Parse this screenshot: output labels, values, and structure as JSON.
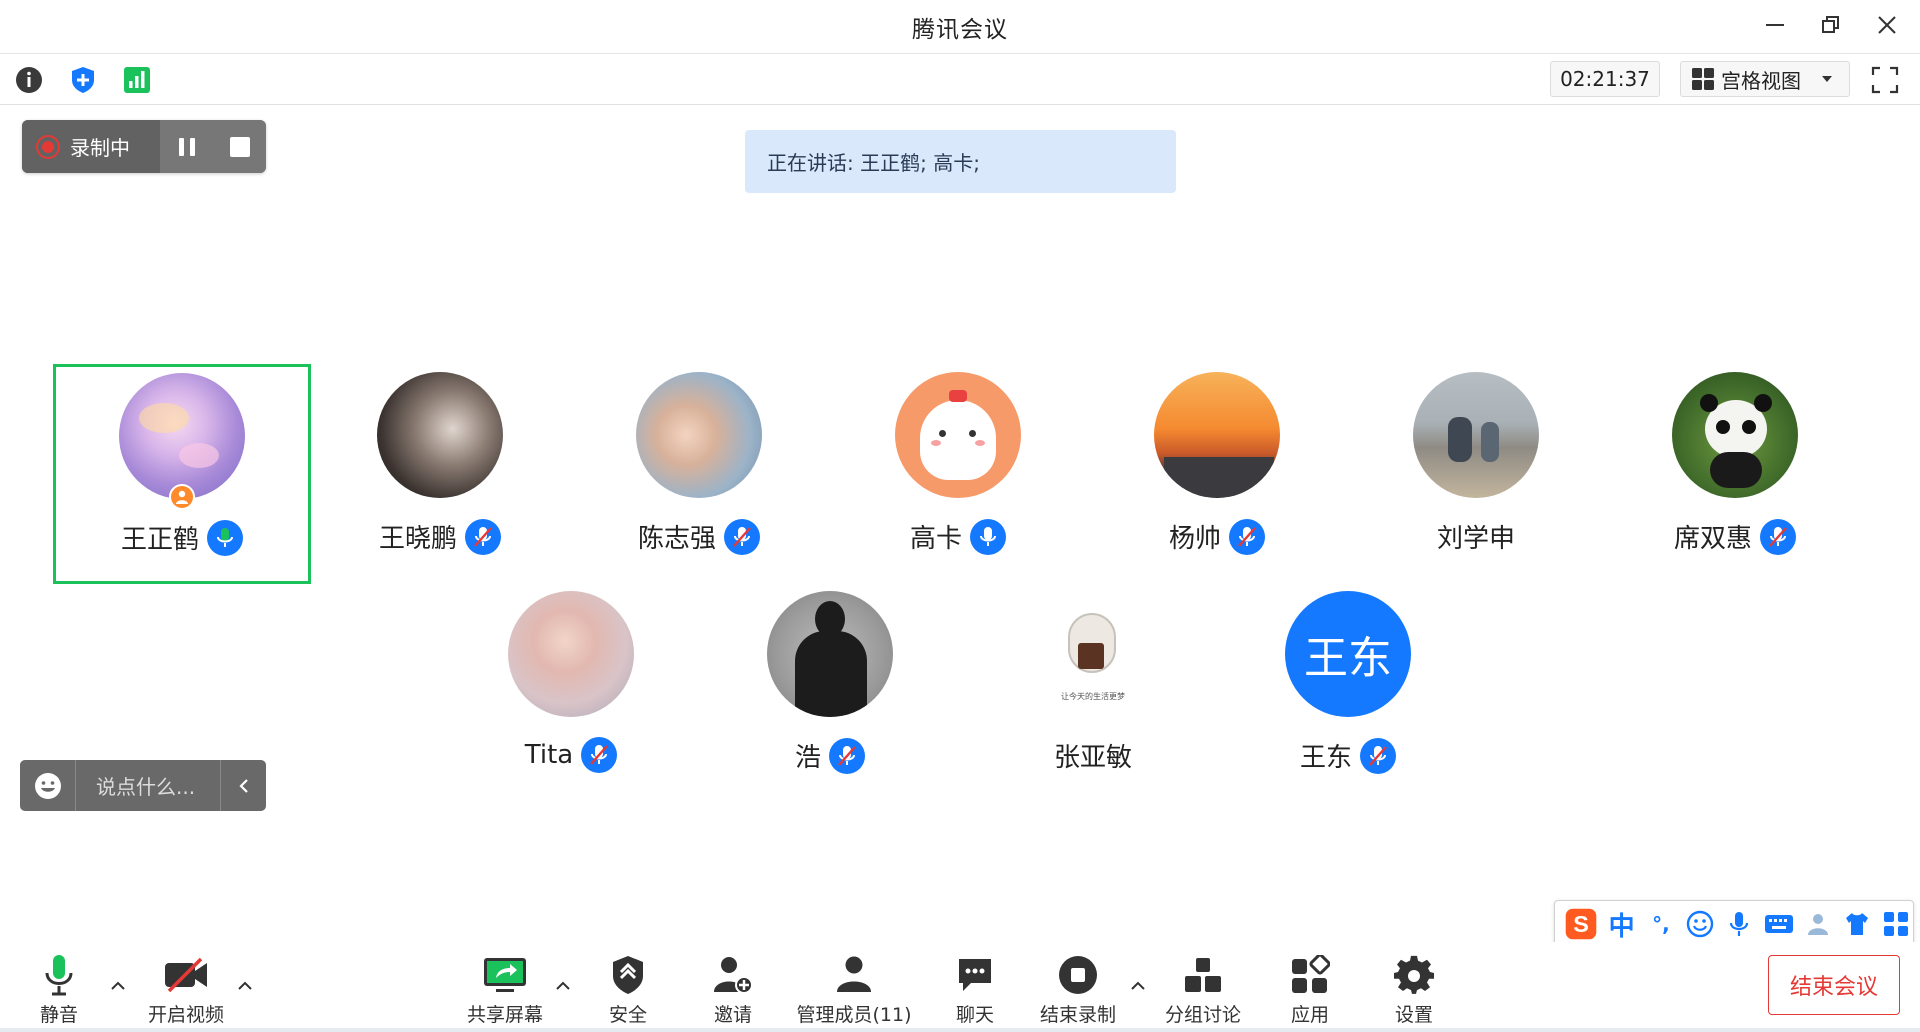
{
  "window": {
    "title": "腾讯会议"
  },
  "infobar": {
    "timer": "02:21:37",
    "view_label": "宫格视图"
  },
  "recording": {
    "status": "录制中"
  },
  "speaking": {
    "text": "正在讲话: 王正鹤; 高卡;"
  },
  "participants": [
    {
      "name": "王正鹤",
      "mic": "on-green",
      "host": true,
      "active": true
    },
    {
      "name": "王晓鹏",
      "mic": "muted"
    },
    {
      "name": "陈志强",
      "mic": "muted"
    },
    {
      "name": "高卡",
      "mic": "on"
    },
    {
      "name": "杨帅",
      "mic": "muted"
    },
    {
      "name": "刘学申",
      "mic": "none"
    },
    {
      "name": "席双惠",
      "mic": "muted"
    },
    {
      "name": "Tita",
      "mic": "muted"
    },
    {
      "name": "浩",
      "mic": "muted"
    },
    {
      "name": "张亚敏",
      "mic": "none",
      "avatar_caption": "让今天的生活更梦"
    },
    {
      "name": "王东",
      "mic": "muted",
      "avatar_text": "王东",
      "avatar_color": "#1479ff"
    }
  ],
  "chat": {
    "placeholder": "说点什么..."
  },
  "ime": {
    "lang": "中",
    "punct": "°,"
  },
  "toolbar": {
    "mute": "静音",
    "video": "开启视频",
    "share": "共享屏幕",
    "security": "安全",
    "invite": "邀请",
    "members": "管理成员(11)",
    "chat": "聊天",
    "end_record": "结束录制",
    "breakout": "分组讨论",
    "apps": "应用",
    "settings": "设置",
    "end_meeting": "结束会议"
  },
  "colors": {
    "accent": "#1479ff",
    "active_border": "#1bc15a",
    "danger": "#e53935",
    "mic_green": "#1bc15a"
  }
}
